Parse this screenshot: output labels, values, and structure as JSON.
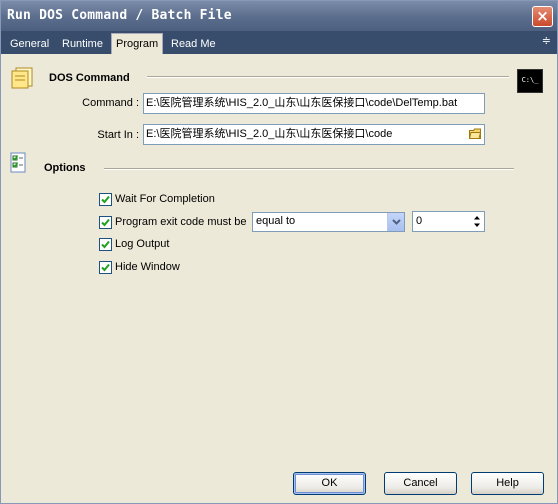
{
  "window": {
    "title": "Run DOS Command / Batch File",
    "close_label": "×"
  },
  "tabs": [
    {
      "label": "General",
      "active": false
    },
    {
      "label": "Runtime",
      "active": false
    },
    {
      "label": "Program",
      "active": true
    },
    {
      "label": "Read Me",
      "active": false
    }
  ],
  "tab_menu_label": "≑",
  "dos_command": {
    "section_title": "DOS Command",
    "cmd_icon_text": "C:\\_",
    "command_label": "Command :",
    "command_value": "E:\\医院管理系统\\HIS_2.0_山东\\山东医保接口\\code\\DelTemp.bat",
    "start_in_label": "Start In :",
    "start_in_value": "E:\\医院管理系统\\HIS_2.0_山东\\山东医保接口\\code"
  },
  "options": {
    "section_title": "Options",
    "wait_for_completion": {
      "label": "Wait For Completion",
      "checked": true
    },
    "exit_code": {
      "label": "Program exit code must be",
      "checked": true,
      "comparison": "equal to",
      "value": "0"
    },
    "log_output": {
      "label": "Log Output",
      "checked": true
    },
    "hide_window": {
      "label": "Hide Window",
      "checked": true
    }
  },
  "buttons": {
    "ok": "OK",
    "cancel": "Cancel",
    "help": "Help"
  },
  "colors": {
    "tabbar": "#384d6b",
    "titlebar": "#5d6f8e",
    "face": "#ece9d8",
    "check": "#21a121"
  }
}
